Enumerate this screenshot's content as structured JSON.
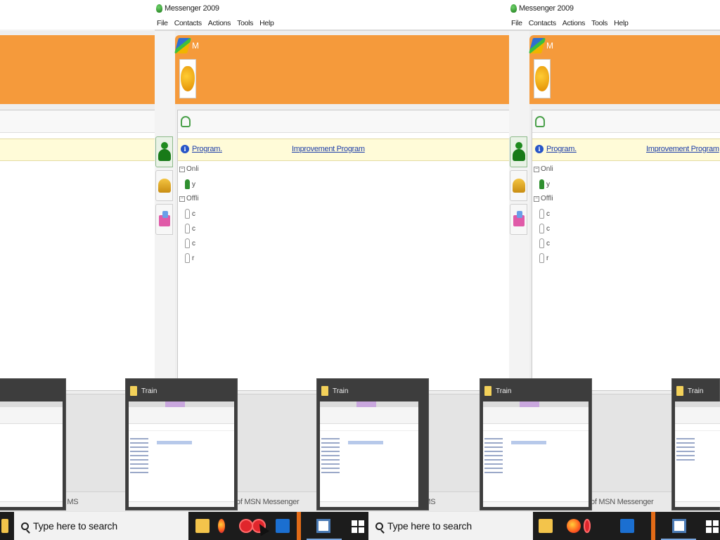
{
  "messenger": {
    "title": "Messenger 2009",
    "menu": [
      "File",
      "Contacts",
      "Actions",
      "Tools",
      "Help"
    ],
    "banner_text": "M",
    "info_links": {
      "left": "Program.",
      "right": "Improvement Program"
    },
    "groups": {
      "online_header": "Onli",
      "online_contact": "y",
      "offline_header": "Offli",
      "offline_contacts": [
        "c",
        "c",
        "c",
        "r"
      ]
    },
    "bottom_text": "of MSN Messenger",
    "bottom_text_short": "of MS"
  },
  "thumbnails": {
    "title": "Train"
  },
  "taskbar": {
    "search_placeholder": "Type here to search"
  },
  "colors": {
    "banner": "#f59a3b",
    "info_bar": "#fffbd8",
    "taskbar": "#1c1c1c",
    "link": "#1f3fa8"
  }
}
